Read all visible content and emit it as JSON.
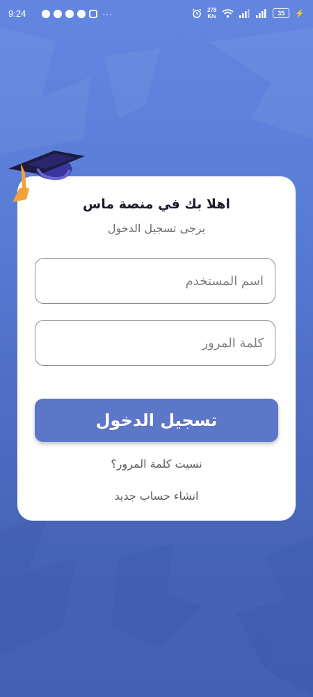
{
  "status_bar": {
    "time": "9:24",
    "more": "···",
    "net_speed_value": "278",
    "net_speed_unit": "K/s",
    "battery": "35",
    "left_icons": [
      "whatsapp-icon",
      "telegram-icon",
      "telegram-icon",
      "telegram-icon",
      "instagram-icon"
    ],
    "right_icons": [
      "alarm-icon",
      "wifi-icon",
      "signal-icon",
      "signal-icon",
      "battery-icon",
      "charging-icon"
    ]
  },
  "login": {
    "title": "اهلا بك في منصة ماس",
    "subtitle": "يرجى تسجيل الدخول",
    "username_placeholder": "اسم المستخدم",
    "password_placeholder": "كلمة المرور",
    "login_label": "تسجيل الدخول",
    "forgot_password": "نسيت كلمة المرور؟",
    "create_account": "انشاء حساب جديد"
  },
  "colors": {
    "background": "#5b7fd8",
    "card": "#ffffff",
    "button": "#5c76c8",
    "cap": "#3e3ba8",
    "tassel": "#f2a23a"
  }
}
